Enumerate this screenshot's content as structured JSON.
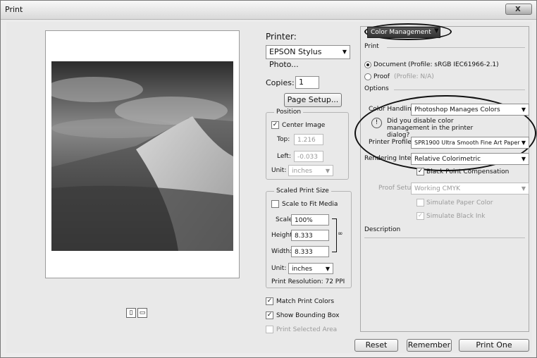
{
  "window": {
    "title": "Print",
    "close_symbol": "x"
  },
  "printer": {
    "label": "Printer:",
    "value": "EPSON Stylus Photo..."
  },
  "copies": {
    "label": "Copies:",
    "value": "1"
  },
  "page_setup": "Page Setup...",
  "position": {
    "legend": "Position",
    "center_image": "Center Image",
    "top_label": "Top:",
    "top_value": "1.216",
    "left_label": "Left:",
    "left_value": "-0.033",
    "unit_label": "Unit:",
    "unit_value": "inches"
  },
  "scaled": {
    "legend": "Scaled Print Size",
    "scale_to_fit": "Scale to Fit Media",
    "scale_label": "Scale:",
    "scale_value": "100%",
    "height_label": "Height:",
    "height_value": "8.333",
    "width_label": "Width:",
    "width_value": "8.333",
    "unit_label": "Unit:",
    "unit_value": "inches",
    "resolution": "Print Resolution: 72 PPI"
  },
  "checks": {
    "match_colors": "Match Print Colors",
    "bounding_box": "Show Bounding Box",
    "selected_area": "Print Selected Area"
  },
  "color_mgmt": {
    "dropdown": "Color Management",
    "print_heading": "Print",
    "document": "Document",
    "document_profile": "(Profile: sRGB IEC61966-2.1)",
    "proof": "Proof",
    "proof_profile": "(Profile: N/A)",
    "options_heading": "Options",
    "color_handling_label": "Color Handling:",
    "color_handling_value": "Photoshop Manages Colors",
    "warning": "Did you disable color management in the printer dialog?",
    "printer_profile_label": "Printer Profile:",
    "printer_profile_value": "SPR1900 Ultra Smooth Fine Art Paper",
    "rendering_intent_label": "Rendering Intent:",
    "rendering_intent_value": "Relative Colorimetric",
    "black_point": "Black Point Compensation",
    "proof_setup_label": "Proof Setup:",
    "proof_setup_value": "Working CMYK",
    "simulate_paper": "Simulate Paper Color",
    "simulate_ink": "Simulate Black Ink",
    "description_heading": "Description"
  },
  "footer": {
    "reset": "Reset",
    "remember": "Remember",
    "print_one": "Print One"
  }
}
